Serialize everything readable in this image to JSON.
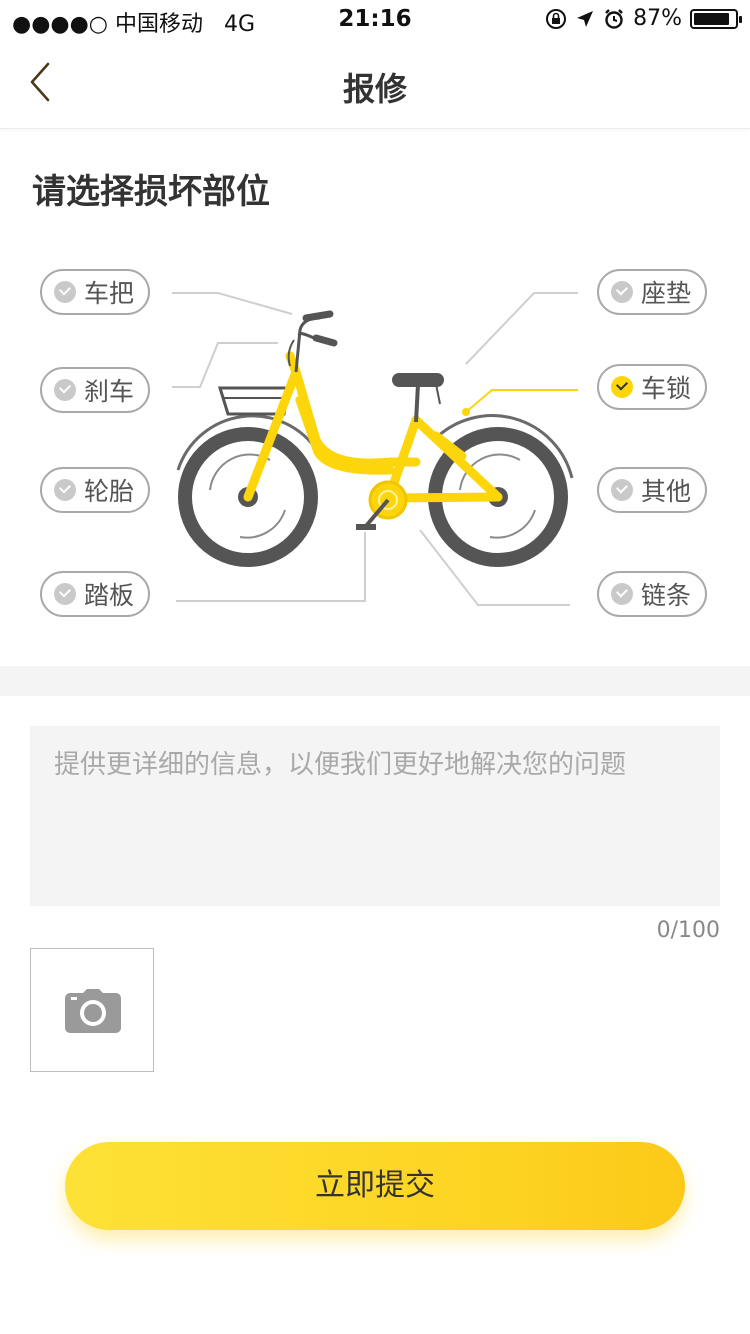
{
  "status_bar": {
    "carrier": "●●●●○ 中国移动",
    "network": "4G",
    "time": "21:16",
    "battery": "87%",
    "battery_level": 0.87,
    "icons": [
      "orientation-lock-icon",
      "location-arrow-icon",
      "alarm-icon",
      "battery-icon"
    ]
  },
  "nav": {
    "title": "报修",
    "back_icon": "chevron-left-icon"
  },
  "section_title": "请选择损坏部位",
  "parts": [
    {
      "label": "车把",
      "selected": false
    },
    {
      "label": "刹车",
      "selected": false
    },
    {
      "label": "轮胎",
      "selected": false
    },
    {
      "label": "踏板",
      "selected": false
    },
    {
      "label": "座垫",
      "selected": false
    },
    {
      "label": "车锁",
      "selected": true
    },
    {
      "label": "其他",
      "selected": false
    },
    {
      "label": "链条",
      "selected": false
    }
  ],
  "description": {
    "placeholder": "提供更详细的信息，以便我们更好地解决您的问题",
    "counter": "0/100"
  },
  "photo_icon": "camera-icon",
  "submit_label": "立即提交",
  "colors": {
    "accent": "#fcd50b",
    "bike_frame": "#fcd50b",
    "wheel": "#555555"
  }
}
